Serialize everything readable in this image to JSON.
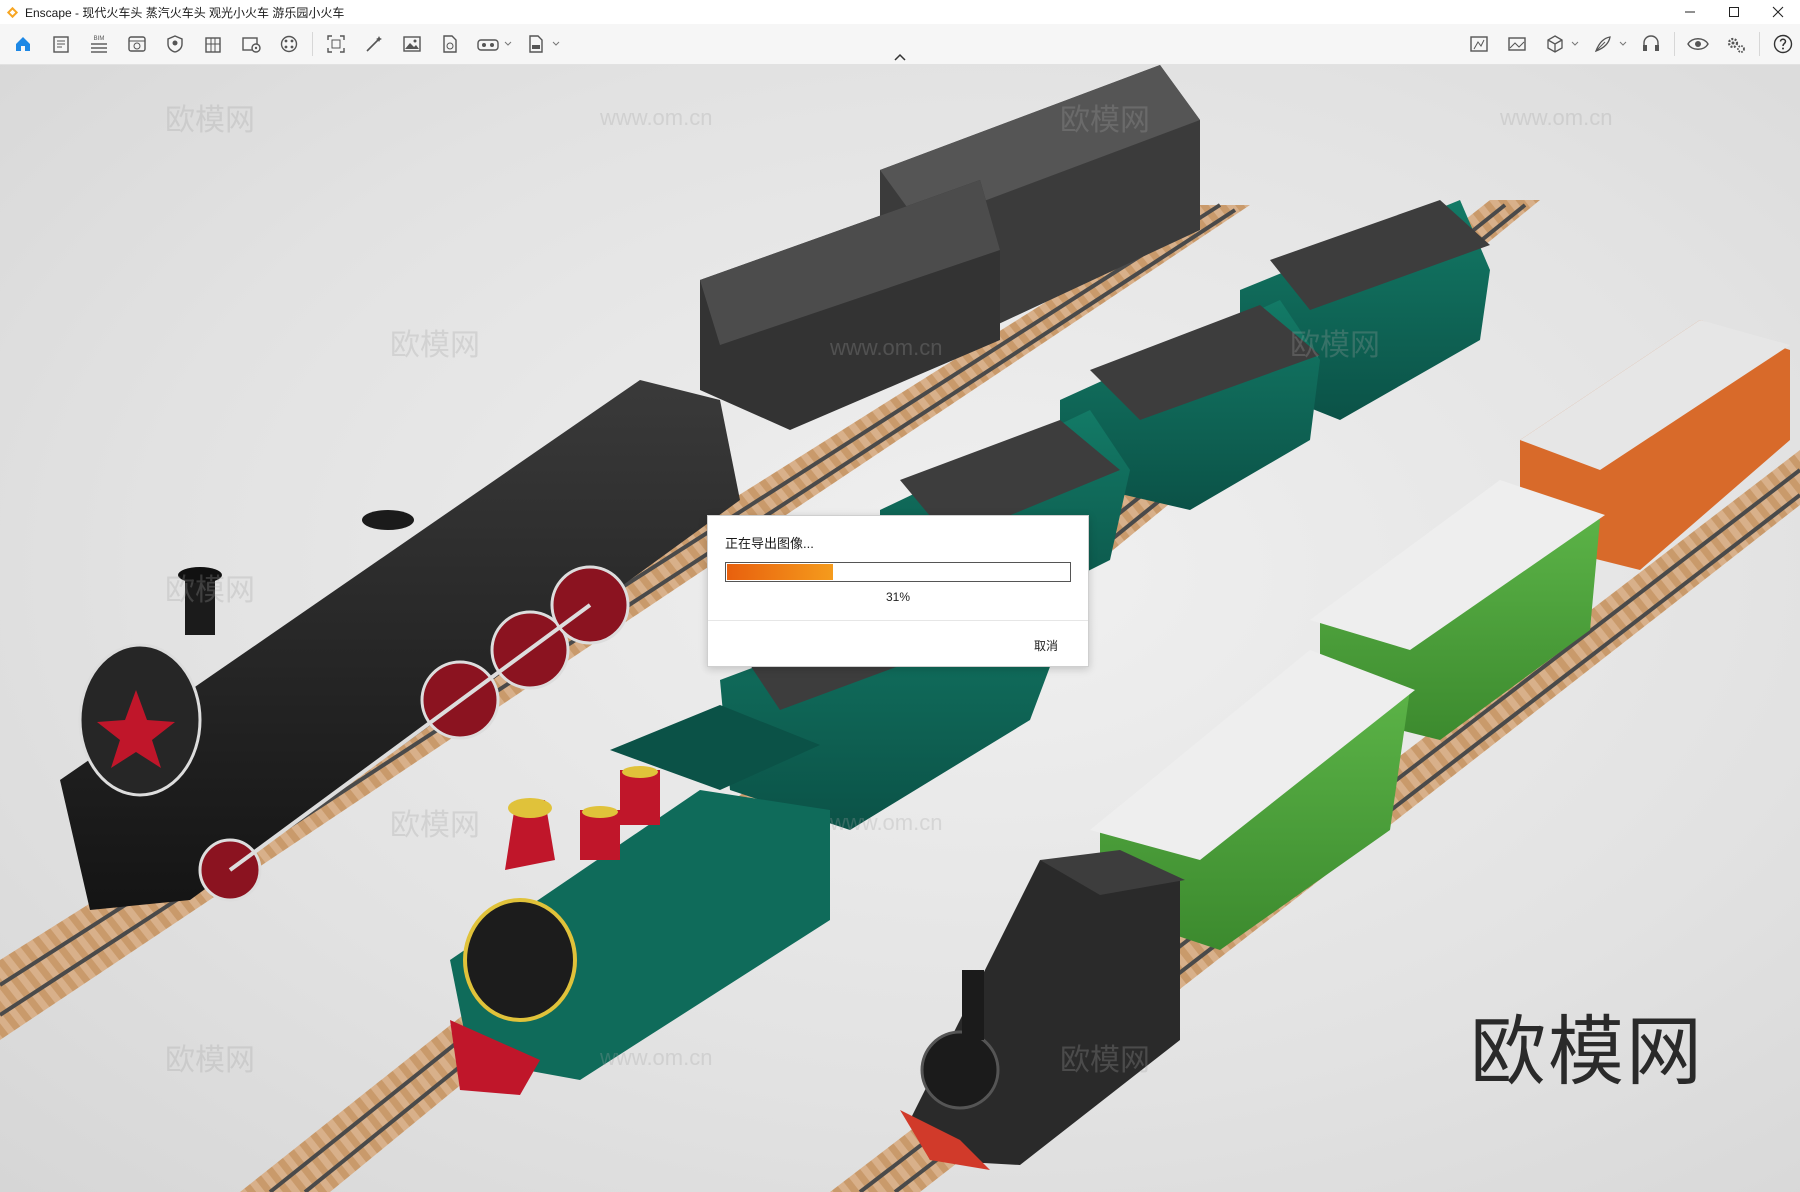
{
  "window": {
    "title": "Enscape - 现代火车头 蒸汽火车头 观光小火车 游乐园小火车"
  },
  "toolbar": {
    "bim_label": "BIM",
    "left_icons": [
      "home-icon",
      "document-icon",
      "bim-icon",
      "window-icon",
      "shield-icon",
      "building-icon",
      "photo-settings-icon",
      "palette-icon",
      "frame-icon",
      "wand-icon",
      "image-icon",
      "file-export-icon",
      "vr-headset-icon",
      "exe-file-icon"
    ],
    "right_icons": [
      "map-icon",
      "panorama-icon",
      "cube-icon",
      "feather-icon",
      "headset-icon",
      "eye-icon",
      "gears-icon",
      "help-icon"
    ]
  },
  "viewport": {
    "watermark": "欧模网",
    "watermark_url": "www.om.cn"
  },
  "dialog": {
    "title": "正在导出图像...",
    "progress_percent": 31,
    "progress_label": "31%",
    "cancel_label": "取消"
  },
  "colors": {
    "accent": "#1e88e5",
    "progress_start": "#e8600e",
    "progress_end": "#f59b1c"
  }
}
